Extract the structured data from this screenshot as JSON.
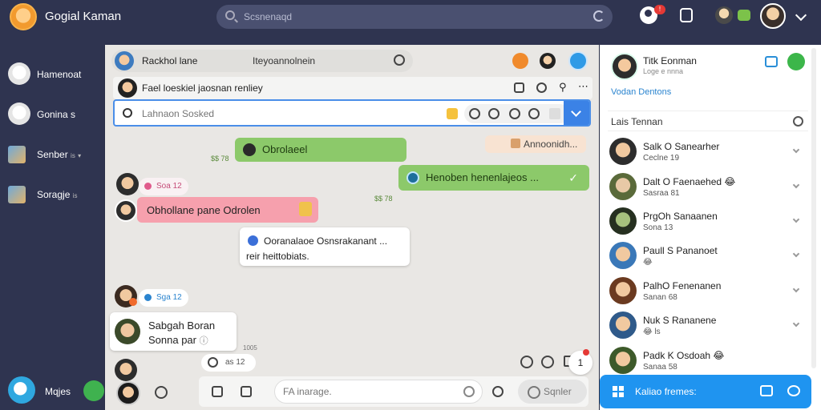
{
  "app": {
    "title": "Gogial Kaman"
  },
  "search": {
    "placeholder": "Scsnenaqd"
  },
  "header": {
    "notification_count": "!"
  },
  "sidebar": {
    "items": [
      {
        "label": "Hamenoat"
      },
      {
        "label": "Gonina s"
      },
      {
        "label": "Senber",
        "extra": "is"
      },
      {
        "label": "Soragje",
        "extra": "is"
      }
    ],
    "bottom_label": "Mqjes"
  },
  "chat": {
    "name": "Rackhol lane",
    "subtitle": "Iteyoannolnein",
    "subheader": "Fael loeskiel jaosnan renliey",
    "find_placeholder": "Lahnaon Sosked",
    "messages": [
      {
        "text": "Obrolaeel",
        "time": "$$ 78"
      },
      {
        "text": "Annoonidh...",
        "kind": "peach"
      },
      {
        "text": "Henoben henenlajeos ...",
        "time": "$$ 78"
      },
      {
        "text": "Obhollane pane Odrolen"
      },
      {
        "text": "Ooranalaoe Osnsrakanant ...",
        "line2": "reir heittobiats."
      },
      {
        "text": "Sabgah Boran",
        "line2": "Sonna par"
      }
    ],
    "pills": [
      {
        "text": "Soa 12"
      },
      {
        "text": "Sga 12"
      },
      {
        "text": "as 12"
      }
    ],
    "timestamp_small": "1005",
    "unread_count": "1",
    "composer": {
      "placeholder": "FA inarage.",
      "send_label": "Sqnler"
    }
  },
  "right_panel": {
    "profile_name": "Titk Eonman",
    "profile_sub": "Loge e nnna",
    "link": "Vodan Dentons",
    "section_title": "Lais Tennan",
    "contacts": [
      {
        "name": "Salk O Sanearher",
        "sub": "Ceclne 19"
      },
      {
        "name": "Dalt O Faenaehed 😂",
        "sub": "Sasraa 81"
      },
      {
        "name": "PrgOh Sanaanen",
        "sub": "Sona 13"
      },
      {
        "name": "Paull S Pananoet",
        "sub": "😂"
      },
      {
        "name": "PalhO Fenenanen",
        "sub": "Sanan 68"
      },
      {
        "name": "Nuk S Rananene",
        "sub": "😂 ls"
      },
      {
        "name": "Padk K Osdoah 😂",
        "sub": "Sanaa 58"
      }
    ],
    "footer_label": "Kaliao fremes:"
  }
}
